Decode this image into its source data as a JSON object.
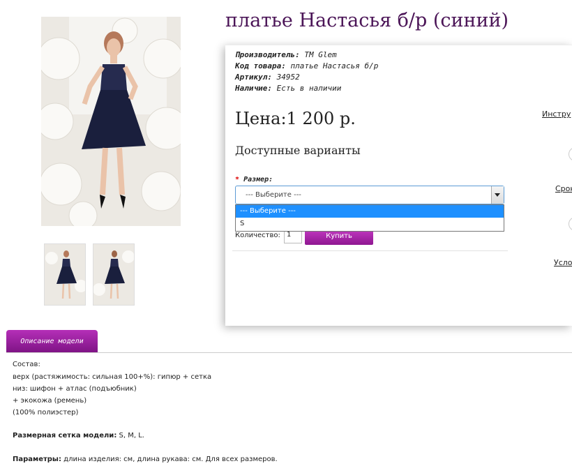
{
  "product": {
    "title": "платье Настасья б/р (синий)",
    "meta": {
      "manufacturer_label": "Производитель:",
      "manufacturer_value": "ТМ Glem",
      "code_label": "Код товара:",
      "code_value": "платье Настасья б/р",
      "article_label": "Артикул:",
      "article_value": "34952",
      "availability_label": "Наличие:",
      "availability_value": "Есть в наличии"
    },
    "price": "Цена:1 200 р.",
    "variants_heading": "Доступные варианты",
    "size_label": "Размер:",
    "size_required_mark": "*",
    "select_value": "--- Выберите ---",
    "options": [
      "--- Выберите ---",
      "S"
    ],
    "quantity_label": "Количество:",
    "quantity_value": "1",
    "buy_button": "Купить"
  },
  "right_links": {
    "instructions": "Инстру",
    "terms": "Срок",
    "conditions": "Усло"
  },
  "tabs": {
    "description": "Описание модели"
  },
  "description": {
    "composition_heading": "Состав:",
    "line1": "верх (растяжимость: сильная 100+%): гипюр + сетка",
    "line2": "низ: шифон + атлас (подъюбник)",
    "line3": "+ экокожа (ремень)",
    "line4": "(100% полиэстер)",
    "size_grid_label": "Размерная сетка модели:",
    "size_grid_value": "S, M, L.",
    "params_label": "Параметры:",
    "params_value": "длина изделия: см, длина рукава: см. Для всех размеров."
  },
  "colors": {
    "title": "#4b1557",
    "accent": "#a3249f",
    "dress": "#1a1f3d",
    "select_highlight": "#1e90ff"
  }
}
